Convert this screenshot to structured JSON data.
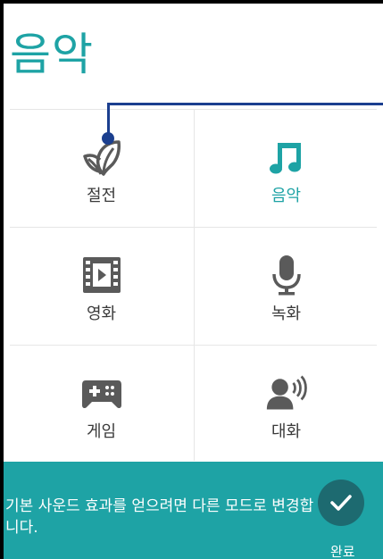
{
  "page": {
    "title": "음악"
  },
  "modes": [
    {
      "label": "절전",
      "icon": "leaf-icon",
      "selected": false
    },
    {
      "label": "음악",
      "icon": "music-note-icon",
      "selected": true
    },
    {
      "label": "영화",
      "icon": "film-icon",
      "selected": false
    },
    {
      "label": "녹화",
      "icon": "microphone-icon",
      "selected": false
    },
    {
      "label": "게임",
      "icon": "gamepad-icon",
      "selected": false
    },
    {
      "label": "대화",
      "icon": "speaking-person-icon",
      "selected": false
    }
  ],
  "hint": {
    "text": "기본 사운드 효과를 얻으려면 다른 모드로 변경합니다.",
    "done_label": "완료"
  },
  "colors": {
    "accent": "#1ea3a5",
    "icon_gray": "#5a5a5a",
    "pointer": "#1b3f8f",
    "done_button": "#1d6a70"
  }
}
